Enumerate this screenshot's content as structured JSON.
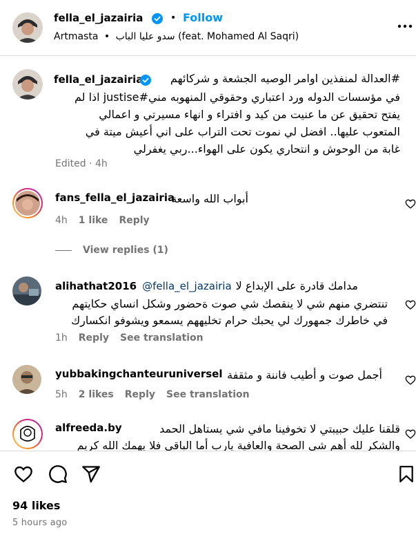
{
  "header": {
    "username": "fella_el_jazairia",
    "follow_label": "Follow",
    "dot": "•",
    "subtitle_artist": "Artmasta",
    "subtitle_dot": "•",
    "subtitle_song": "سدو عليا الباب (feat. Mohamed Al Saqri)",
    "more_icon": "more-horizontal-icon"
  },
  "caption": {
    "username": "fella_el_jazairia",
    "line1": "#العدالة لمنفذين اوامر الوصيه الجشعة و شركائهم",
    "line2": "في مؤسسات الدوله ورد اعتباري وحقوقي المنهوبه مني#justise اذا لم",
    "line3": "يفتح تحقيق عن ما عنيت من كيد و افتراء و انهاء مسيرتي و اعمالي",
    "line4": "المتعوب عليها.. افضل لي نموت تحت التراب على اني أعيش ميتة في",
    "line5": "غابة من الوحوش و انتحاري يكون على الهواء...ربي يغفرلي",
    "edited": "Edited · 4h"
  },
  "comments": [
    {
      "username": "fans_fella_el_jazairia",
      "text": "أبواب الله واسعة",
      "time": "4h",
      "likes": "1 like",
      "reply": "Reply",
      "view_replies": "View replies (1)"
    },
    {
      "username": "alihathat2016",
      "mention": "@fella_el_jazairia",
      "line1": "مدامك قادرة على الإبداع لا",
      "line2": "تنتضري منهم شي لا ينقصك شي صوت ةحضور وشكل انساي حكايتهم",
      "line3": "في خاطرك جمهورك لي يحبك حرام تخليههم يسمعو ويشوفو انكسارك",
      "time": "1h",
      "reply": "Reply",
      "see_translation": "See translation"
    },
    {
      "username": "yubbakingchanteuruniversel",
      "text": "أجمل صوت و أطيب فاننة و مثقفة",
      "time": "5h",
      "likes": "2 likes",
      "reply": "Reply",
      "see_translation": "See translation"
    },
    {
      "username": "alfreeda.by",
      "line1": "قلقنا عليك حبيبتي لا تخوفينا مافي شي يستاهل الحمد",
      "line2": "والشكر لله أهم شي الصحة والعافية يارب أما الباقي فلا يهمك الله كريم"
    }
  ],
  "actions": {
    "like_icon": "heart-icon",
    "comment_icon": "comment-icon",
    "share_icon": "share-icon",
    "save_icon": "bookmark-icon"
  },
  "footer": {
    "likes": "94 likes",
    "time_ago": "5 hours ago"
  },
  "colors": {
    "link_blue": "#0095f6",
    "muted": "#737373",
    "divider": "#dbdbdb"
  }
}
